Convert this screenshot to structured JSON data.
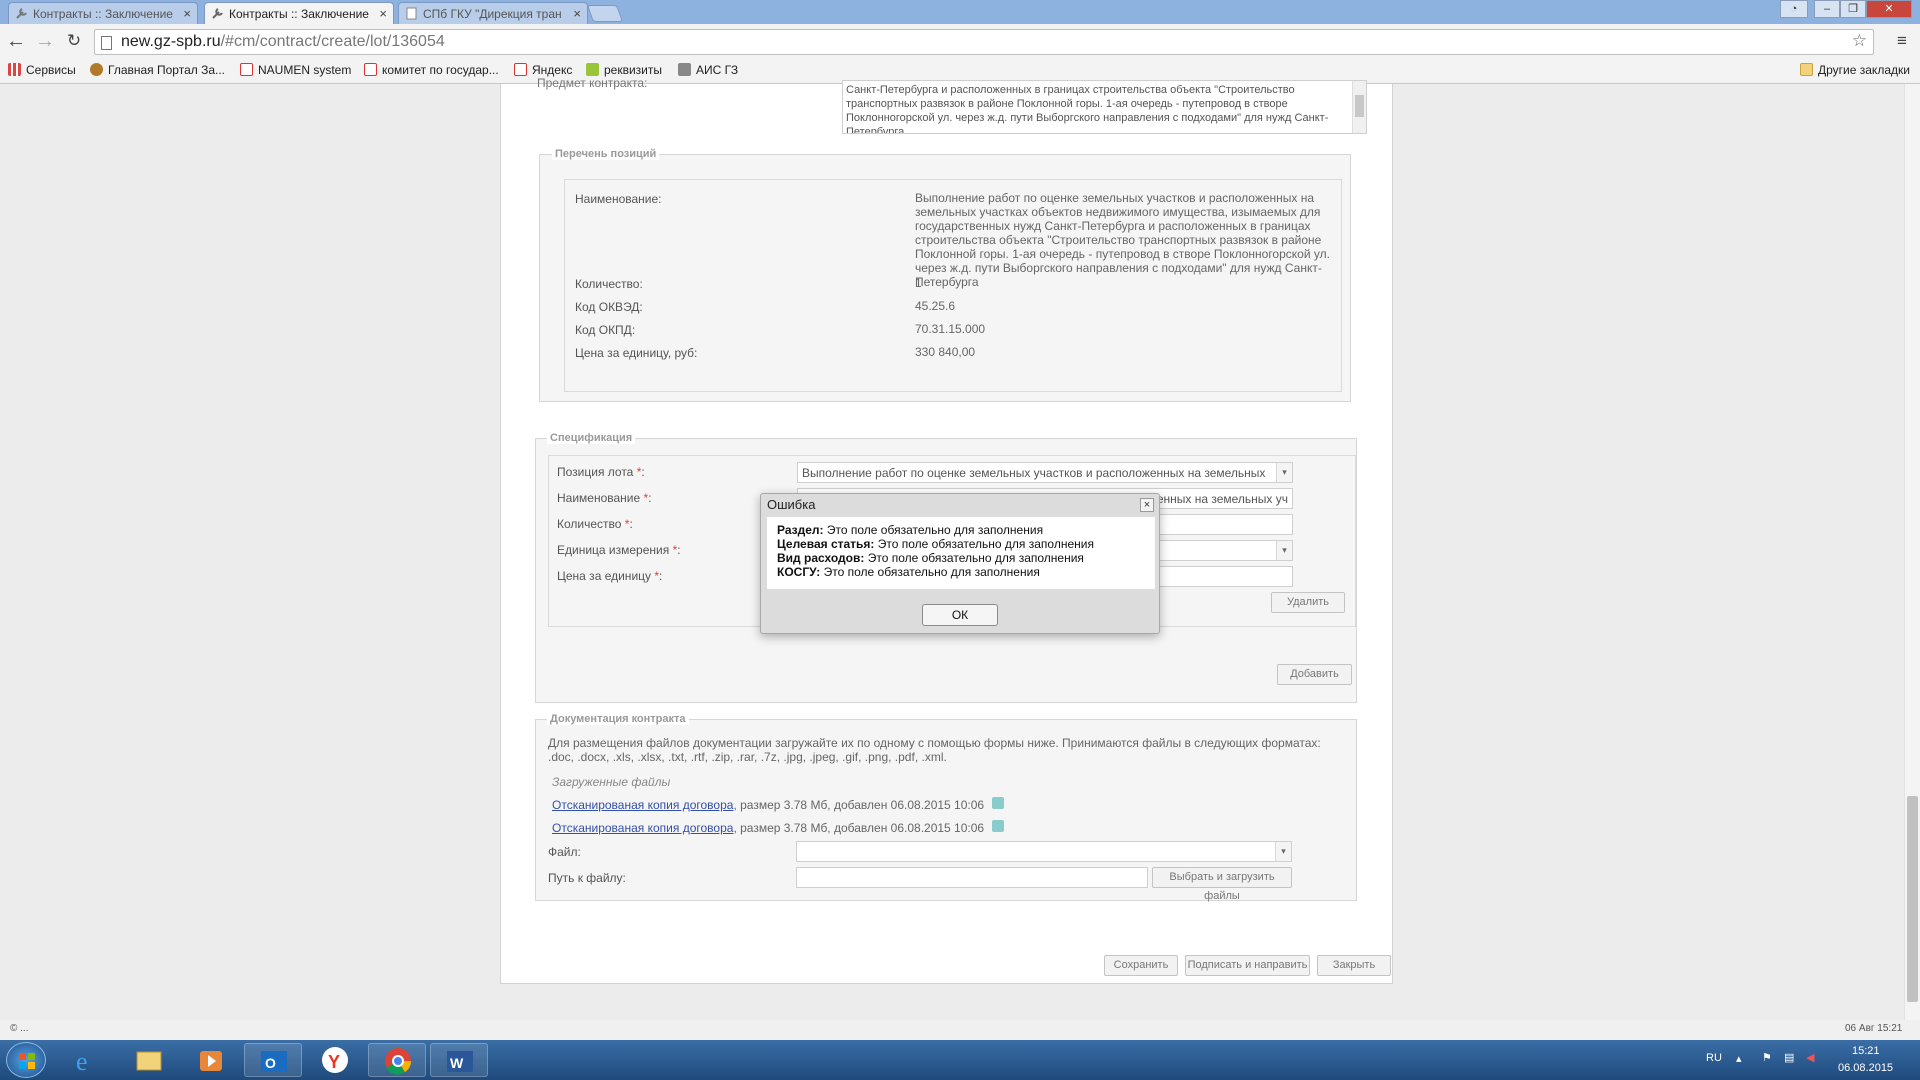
{
  "browser": {
    "tabs": [
      {
        "title": "Контракты :: Заключение",
        "active": false
      },
      {
        "title": "Контракты :: Заключение",
        "active": true
      },
      {
        "title": "СПб ГКУ \"Дирекция тран",
        "active": false
      }
    ],
    "url_host": "new.gz-spb.ru",
    "url_path": "/#cm/contract/create/lot/136054",
    "bookmarks": [
      "Сервисы",
      "Главная Портал За...",
      "NAUMEN system",
      "комитет по государ...",
      "Яндекс",
      "реквизиты",
      "АИС ГЗ"
    ],
    "other_bookmarks": "Другие закладки"
  },
  "subject": {
    "label": "Предмет контракта:",
    "text": "Санкт-Петербурга и расположенных в границах строительства объекта \"Строительство транспортных развязок в районе Поклонной горы. 1-ая очередь - путепровод в створе Поклонногорской ул. через ж.д. пути Выборгского направления с подходами\" для нужд Санкт-Петербурга"
  },
  "positions": {
    "legend": "Перечень позиций",
    "name_label": "Наименование:",
    "name_value": "Выполнение работ по оценке земельных участков и расположенных на земельных участках объектов недвижимого имущества, изымаемых для государственных нужд Санкт-Петербурга и расположенных в границах строительства объекта \"Строительство транспортных развязок в районе Поклонной горы. 1-ая очередь - путепровод в створе Поклонногорской ул. через ж.д. пути Выборгского направления с подходами\" для нужд Санкт-Петербурга",
    "qty_label": "Количество:",
    "qty_value": "1",
    "okved_label": "Код ОКВЭД:",
    "okved_value": "45.25.6",
    "okpd_label": "Код ОКПД:",
    "okpd_value": "70.31.15.000",
    "price_label": "Цена за единицу, руб:",
    "price_value": "330 840,00"
  },
  "spec": {
    "legend": "Спецификация",
    "lot_position_label": "Позиция лота",
    "lot_position_value": "Выполнение работ по оценке земельных участков и расположенных на земельных",
    "name_label": "Наименование",
    "name_value": "асположенных на земельных уч",
    "qty_label": "Количество",
    "unit_label": "Единица измерения",
    "price_label": "Цена за единицу",
    "req": "*",
    "colon": ":",
    "delete_btn": "Удалить",
    "add_btn": "Добавить"
  },
  "docs": {
    "legend": "Документация контракта",
    "info": "Для размещения файлов документации загружайте их по одному с помощью формы ниже. Принимаются файлы в следующих форматах: .doc, .docx, .xls, .xlsx, .txt, .rtf, .zip, .rar, .7z, .jpg, .jpeg, .gif, .png, .pdf, .xml.",
    "uploaded_title": "Загруженные файлы",
    "files": [
      {
        "link": "Отсканированая копия договора",
        "meta": ", размер 3.78 Мб, добавлен 06.08.2015 10:06"
      },
      {
        "link": "Отсканированая копия договора",
        "meta": ", размер 3.78 Мб, добавлен 06.08.2015 10:06"
      }
    ],
    "file_label": "Файл:",
    "path_label": "Путь к файлу:",
    "upload_btn": "Выбрать и загрузить файлы"
  },
  "actions": {
    "save": "Сохранить",
    "sign_send": "Подписать и направить",
    "close": "Закрыть"
  },
  "dialog": {
    "title": "Ошибка",
    "close_icon": "×",
    "errors": [
      {
        "field": "Раздел:",
        "msg": " Это поле обязательно для заполнения"
      },
      {
        "field": "Целевая статья:",
        "msg": " Это поле обязательно для заполнения"
      },
      {
        "field": "Вид расходов:",
        "msg": " Это поле обязательно для заполнения"
      },
      {
        "field": "КОСГУ:",
        "msg": " Это поле обязательно для заполнения"
      }
    ],
    "ok": "ОК"
  },
  "statusbar": {
    "left": "© ...",
    "right": "06 Авг 15:21"
  },
  "taskbar": {
    "lang": "RU",
    "time": "15:21",
    "date": "06.08.2015"
  },
  "colors": {
    "taskbar": "#2a5a92",
    "tabstrip": "#8db2e0",
    "link": "#3350a8",
    "required": "#e03c3c"
  }
}
